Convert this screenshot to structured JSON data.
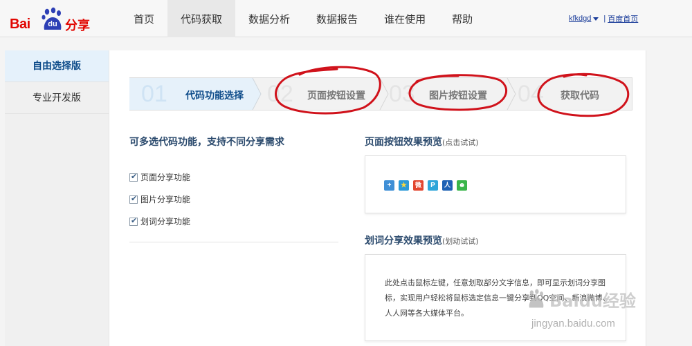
{
  "brand": {
    "logo_left": "Bai",
    "logo_paw": "du",
    "logo_right": "分享"
  },
  "nav": {
    "items": [
      {
        "label": "首页"
      },
      {
        "label": "代码获取"
      },
      {
        "label": "数据分析"
      },
      {
        "label": "数据报告"
      },
      {
        "label": "谁在使用"
      },
      {
        "label": "帮助"
      }
    ],
    "active_index": 1
  },
  "user": {
    "name": "kfkdgd",
    "home_link": "百度首页",
    "separator": "|"
  },
  "sidebar": {
    "items": [
      {
        "label": "自由选择版"
      },
      {
        "label": "专业开发版"
      }
    ]
  },
  "steps": [
    {
      "num": "01",
      "label": "代码功能选择"
    },
    {
      "num": "02",
      "label": "页面按钮设置"
    },
    {
      "num": "03",
      "label": "图片按钮设置"
    },
    {
      "num": "04",
      "label": "获取代码"
    }
  ],
  "options": {
    "heading": "可多选代码功能，支持不同分享需求",
    "items": [
      {
        "label": "页面分享功能",
        "checked": true
      },
      {
        "label": "图片分享功能",
        "checked": true
      },
      {
        "label": "划词分享功能",
        "checked": true
      }
    ]
  },
  "page_preview": {
    "title": "页面按钮效果预览",
    "hint": "(点击试试)"
  },
  "select_preview": {
    "title": "划词分享效果预览",
    "hint": "(划动试试)",
    "text": "此处点击鼠标左键，任意划取部分文字信息，即可显示划词分享图标，实现用户轻松将鼠标选定信息一键分享到QQ空间、新浪微博、人人网等各大媒体平台。"
  },
  "share_icons": [
    {
      "icon": "plus-share-icon",
      "glyph": "+",
      "color": "#3f8fd6"
    },
    {
      "icon": "qzone-star-icon",
      "glyph": "★",
      "color": "#2c9ad8"
    },
    {
      "icon": "sina-weibo-icon",
      "glyph": "微",
      "color": "#e2462f"
    },
    {
      "icon": "tencent-weibo-icon",
      "glyph": "P",
      "color": "#2fa6d9"
    },
    {
      "icon": "renren-icon",
      "glyph": "人",
      "color": "#1d61b4"
    },
    {
      "icon": "wechat-icon",
      "glyph": "☻",
      "color": "#39b54a"
    }
  ],
  "watermark": {
    "main": "Baidu经验",
    "sub": "jingyan.baidu.com"
  },
  "colors": {
    "brand_red": "#e10601",
    "annotation_red": "#d0121b",
    "link_blue": "#1a3c9a",
    "active_step_text": "#0e4c8a"
  }
}
